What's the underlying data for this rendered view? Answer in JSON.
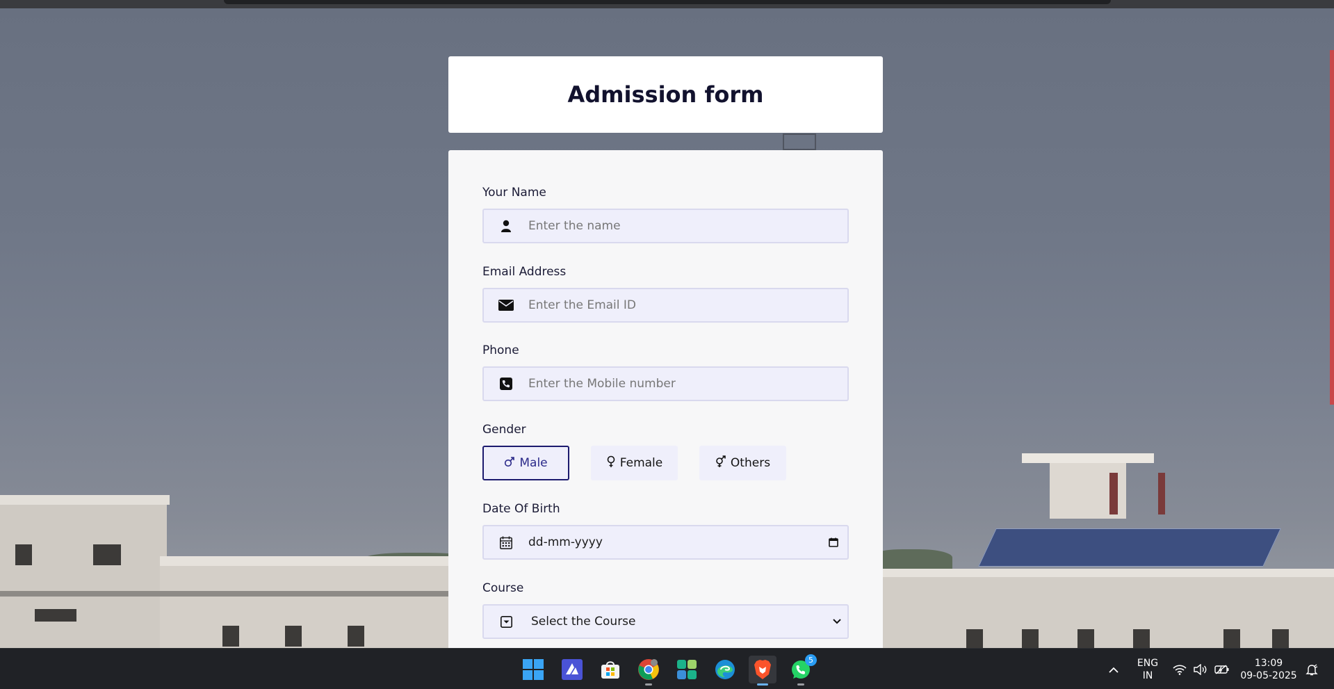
{
  "form": {
    "title": "Admission form",
    "name": {
      "label": "Your Name",
      "placeholder": "Enter the name",
      "icon": "user-icon"
    },
    "email": {
      "label": "Email Address",
      "placeholder": "Enter the Email ID",
      "icon": "envelope-icon"
    },
    "phone": {
      "label": "Phone",
      "placeholder": "Enter the Mobile number",
      "icon": "phone-icon"
    },
    "gender": {
      "label": "Gender",
      "options": [
        {
          "label": "Male",
          "icon": "male-symbol-icon",
          "selected": true
        },
        {
          "label": "Female",
          "icon": "female-symbol-icon",
          "selected": false
        },
        {
          "label": "Others",
          "icon": "others-symbol-icon",
          "selected": false
        }
      ]
    },
    "dob": {
      "label": "Date Of Birth",
      "value": "dd-mm-yyyy",
      "icon": "calendar-icon"
    },
    "course": {
      "label": "Course",
      "selected": "Select the Course",
      "icon": "caret-square-icon"
    }
  },
  "taskbar": {
    "apps": [
      "windows-start-icon",
      "antivirus-app-icon",
      "microsoft-store-icon",
      "chrome-icon",
      "widgets-app-icon",
      "edge-icon",
      "brave-icon",
      "whatsapp-icon"
    ],
    "whatsapp_badge": "5",
    "language": "ENG",
    "region": "IN",
    "time": "13:09",
    "date": "09-05-2025"
  },
  "colors": {
    "accent": "#1c1a6e",
    "input_bg": "#efeffb",
    "title_text": "#12122e",
    "taskbar": "#202226"
  }
}
